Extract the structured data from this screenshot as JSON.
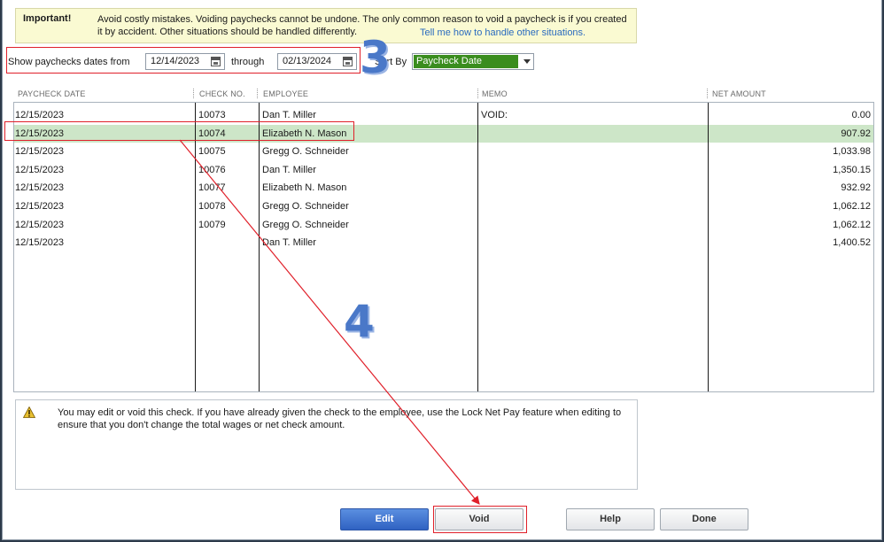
{
  "banner": {
    "important_label": "Important!",
    "message": "Avoid costly mistakes. Voiding paychecks cannot be undone. The only common reason to void a paycheck is if you created it by accident. Other situations should be handled differently.",
    "link": "Tell me how to handle other situations."
  },
  "filter": {
    "show_label": "Show paychecks dates from",
    "from_date": "12/14/2023",
    "through_label": "through",
    "to_date": "02/13/2024",
    "sort_label": "Sort By",
    "sort_value": "Paycheck Date"
  },
  "annotations": {
    "step3": "3",
    "step4": "4"
  },
  "table": {
    "headers": {
      "date": "PAYCHECK DATE",
      "check": "CHECK NO.",
      "employee": "EMPLOYEE",
      "memo": "MEMO",
      "amount": "NET AMOUNT"
    },
    "rows": [
      {
        "date": "12/15/2023",
        "check": "10073",
        "employee": "Dan T. Miller",
        "memo": "VOID:",
        "amount": "0.00"
      },
      {
        "date": "12/15/2023",
        "check": "10074",
        "employee": "Elizabeth N. Mason",
        "memo": "",
        "amount": "907.92"
      },
      {
        "date": "12/15/2023",
        "check": "10075",
        "employee": "Gregg O. Schneider",
        "memo": "",
        "amount": "1,033.98"
      },
      {
        "date": "12/15/2023",
        "check": "10076",
        "employee": "Dan T. Miller",
        "memo": "",
        "amount": "1,350.15"
      },
      {
        "date": "12/15/2023",
        "check": "10077",
        "employee": "Elizabeth N. Mason",
        "memo": "",
        "amount": "932.92"
      },
      {
        "date": "12/15/2023",
        "check": "10078",
        "employee": "Gregg O. Schneider",
        "memo": "",
        "amount": "1,062.12"
      },
      {
        "date": "12/15/2023",
        "check": "10079",
        "employee": "Gregg O. Schneider",
        "memo": "",
        "amount": "1,062.12"
      },
      {
        "date": "12/15/2023",
        "check": "",
        "employee": "Dan T. Miller",
        "memo": "",
        "amount": "1,400.52"
      }
    ],
    "selected_row": 1
  },
  "info": {
    "message": "You may edit or void this check. If you have already given the check to the employee, use the Lock Net Pay feature when editing to ensure that you don't change the total wages or net check amount."
  },
  "buttons": {
    "edit": "Edit",
    "void": "Void",
    "help": "Help",
    "done": "Done"
  },
  "colors": {
    "selected_row": "#cde6c8",
    "sort_value_bg": "#3a8d1e",
    "annotation_red": "#e0202a",
    "annotation_blue": "#4a78c8",
    "link": "#2a6bbf"
  }
}
